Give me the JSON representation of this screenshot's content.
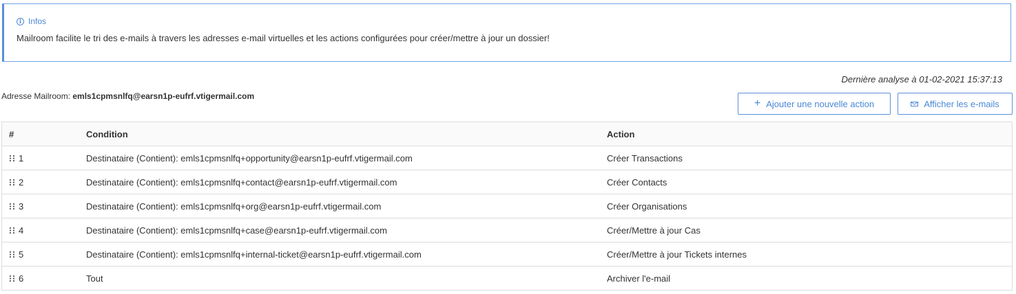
{
  "info": {
    "title": "Infos",
    "text": "Mailroom facilite le tri des e-mails à travers les adresses e-mail virtuelles et les actions configurées pour créer/mettre à jour un dossier!"
  },
  "last_analysis": "Dernière analyse à 01-02-2021 15:37:13",
  "address": {
    "label": "Adresse Mailroom:",
    "value": "emls1cpmsnlfq@earsn1p-eufrf.vtigermail.com"
  },
  "buttons": {
    "add_action": "Ajouter une nouvelle action",
    "view_emails": "Afficher les e-mails"
  },
  "table": {
    "headers": [
      "#",
      "Condition",
      "Action"
    ],
    "rows": [
      {
        "num": "1",
        "condition": "Destinataire (Contient): emls1cpmsnlfq+opportunity@earsn1p-eufrf.vtigermail.com",
        "action": "Créer Transactions"
      },
      {
        "num": "2",
        "condition": "Destinataire (Contient): emls1cpmsnlfq+contact@earsn1p-eufrf.vtigermail.com",
        "action": "Créer Contacts"
      },
      {
        "num": "3",
        "condition": "Destinataire (Contient): emls1cpmsnlfq+org@earsn1p-eufrf.vtigermail.com",
        "action": "Créer Organisations"
      },
      {
        "num": "4",
        "condition": "Destinataire (Contient): emls1cpmsnlfq+case@earsn1p-eufrf.vtigermail.com",
        "action": "Créer/Mettre à jour Cas"
      },
      {
        "num": "5",
        "condition": "Destinataire (Contient): emls1cpmsnlfq+internal-ticket@earsn1p-eufrf.vtigermail.com",
        "action": "Créer/Mettre à jour Tickets internes"
      },
      {
        "num": "6",
        "condition": "Tout",
        "action": "Archiver l'e-mail"
      }
    ]
  },
  "colors": {
    "accent": "#4a88d6",
    "border": "#dcdcdc"
  },
  "icons": {
    "info": "info-icon",
    "plus": "plus-icon",
    "mail": "envelope-icon",
    "drag": "drag-handle-icon"
  }
}
